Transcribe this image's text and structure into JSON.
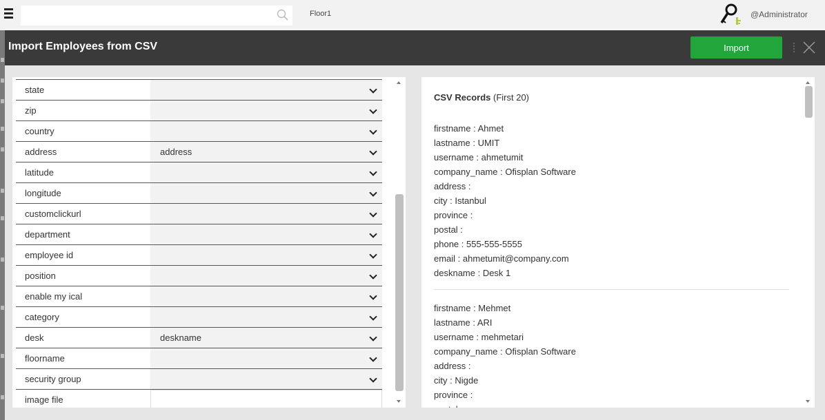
{
  "topbar": {
    "search_placeholder": "",
    "floor": "Floor1",
    "user": "@Administrator"
  },
  "modal": {
    "title": "Import Employees from CSV",
    "import_label": "Import"
  },
  "fields": [
    {
      "label": "state",
      "value": ""
    },
    {
      "label": "zip",
      "value": ""
    },
    {
      "label": "country",
      "value": ""
    },
    {
      "label": "address",
      "value": "address"
    },
    {
      "label": "latitude",
      "value": ""
    },
    {
      "label": "longitude",
      "value": ""
    },
    {
      "label": "customclickurl",
      "value": ""
    },
    {
      "label": "department",
      "value": ""
    },
    {
      "label": "employee id",
      "value": ""
    },
    {
      "label": "position",
      "value": ""
    },
    {
      "label": "enable my ical",
      "value": ""
    },
    {
      "label": "category",
      "value": ""
    },
    {
      "label": "desk",
      "value": "deskname"
    },
    {
      "label": "floorname",
      "value": ""
    },
    {
      "label": "security group",
      "value": ""
    },
    {
      "label": "image file",
      "value": ""
    }
  ],
  "csv": {
    "title": "CSV Records",
    "subtitle": "(First 20)",
    "records": [
      [
        "firstname : Ahmet",
        "lastname : UMIT",
        "username : ahmetumit",
        "company_name : Ofisplan Software",
        "address :",
        "city : Istanbul",
        "province :",
        "postal :",
        "phone : 555-555-5555",
        "email : ahmetumit@company.com",
        "deskname : Desk 1"
      ],
      [
        "firstname : Mehmet",
        "lastname : ARI",
        "username : mehmetari",
        "company_name : Ofisplan Software",
        "address :",
        "city : Nigde",
        "province :",
        "postal :"
      ]
    ]
  }
}
